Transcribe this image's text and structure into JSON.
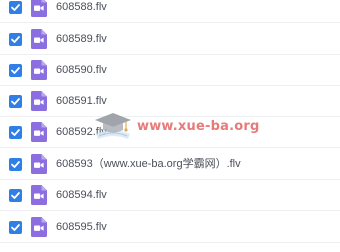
{
  "files": [
    {
      "name": "608588.flv",
      "checked": true
    },
    {
      "name": "608589.flv",
      "checked": true
    },
    {
      "name": "608590.flv",
      "checked": true
    },
    {
      "name": "608591.flv",
      "checked": true
    },
    {
      "name": "608592.flv",
      "checked": true
    },
    {
      "name": "608593（www.xue-ba.org学霸网）.flv",
      "checked": true
    },
    {
      "name": "608594.flv",
      "checked": true
    },
    {
      "name": "608595.flv",
      "checked": true
    }
  ],
  "icons": {
    "checkbox": "checkbox-checked-icon",
    "file": "video-file-icon"
  },
  "colors": {
    "checkbox": "#2f7fe6",
    "file_icon": "#8b6fe0",
    "watermark_text": "#e15555"
  },
  "watermark": {
    "text": "www.xue-ba.org"
  }
}
